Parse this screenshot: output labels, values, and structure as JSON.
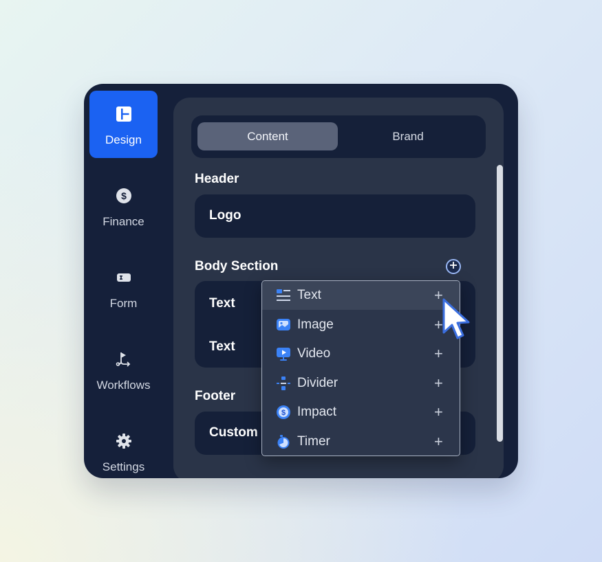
{
  "sidebar": {
    "items": [
      {
        "label": "Design",
        "icon": "layout-icon",
        "active": true
      },
      {
        "label": "Finance",
        "icon": "dollar-icon"
      },
      {
        "label": "Form",
        "icon": "form-field-icon"
      },
      {
        "label": "Workflows",
        "icon": "workflow-icon"
      },
      {
        "label": "Settings",
        "icon": "gear-icon"
      }
    ]
  },
  "tabs": [
    {
      "label": "Content",
      "active": true
    },
    {
      "label": "Brand"
    }
  ],
  "header_section": {
    "title": "Header",
    "rows": [
      "Logo"
    ]
  },
  "body_section": {
    "title": "Body Section",
    "rows": [
      "Text",
      "Text"
    ]
  },
  "footer_section": {
    "title": "Footer",
    "rows": [
      "Custom F"
    ]
  },
  "add_menu": {
    "items": [
      {
        "label": "Text",
        "icon": "text-block-icon",
        "action": "+"
      },
      {
        "label": "Image",
        "icon": "image-icon",
        "action": "+"
      },
      {
        "label": "Video",
        "icon": "video-icon",
        "action": "+"
      },
      {
        "label": "Divider",
        "icon": "divider-icon",
        "action": "+"
      },
      {
        "label": "Impact",
        "icon": "impact-dollar-icon",
        "action": "+"
      },
      {
        "label": "Timer",
        "icon": "timer-icon",
        "action": "+"
      }
    ]
  },
  "colors": {
    "accent": "#1b62f2",
    "app_bg": "#15203a",
    "panel_bg": "#2a3448",
    "icon_blue": "#3b82f6"
  }
}
